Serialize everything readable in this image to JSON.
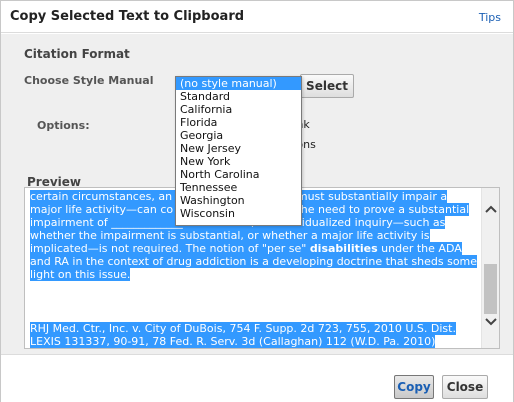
{
  "dialog": {
    "title": "Copy Selected Text to Clipboard",
    "tips_link": "Tips"
  },
  "citation": {
    "section_title": "Citation Format",
    "style_label": "Choose Style Manual",
    "select_button": "Select",
    "options_label": "Options:",
    "option_text_1": "erlink",
    "option_text_2": "tions"
  },
  "dropdown": {
    "items": [
      "(no style manual)",
      "Standard",
      "California",
      "Florida",
      "Georgia",
      "New Jersey",
      "New York",
      "North Carolina",
      "Tennessee",
      "Washington",
      "Wisconsin"
    ],
    "selected": "(no style manual)"
  },
  "preview": {
    "label": "Preview",
    "text_before_bold": "certain circumstances, an ________________ ually must substantially impair a major life activity—can co _____________ without the need to prove a substantial impairment of _____________ such a case, an individualized inquiry—such as whether the impairment is substantial, or whether a major life activity is implicated—is not required. The notion of \"per se\" ",
    "bold_word": "disabilities",
    "text_after_bold": " under the ADA and RA in the context of drug addiction is a developing doctrine that sheds some light on this issue.",
    "citation": "RHJ Med. Ctr., Inc. v. City of DuBois, 754 F. Supp. 2d 723, 755, 2010 U.S. Dist. LEXIS 131337, 90-91, 78 Fed. R. Serv. 3d (Callaghan) 112 (W.D. Pa. 2010)"
  },
  "footer": {
    "copy_button": "Copy",
    "close_button": "Close"
  },
  "colors": {
    "selection": "#3399ff",
    "link": "#1a5fb4",
    "panel_bg": "#efefef"
  }
}
